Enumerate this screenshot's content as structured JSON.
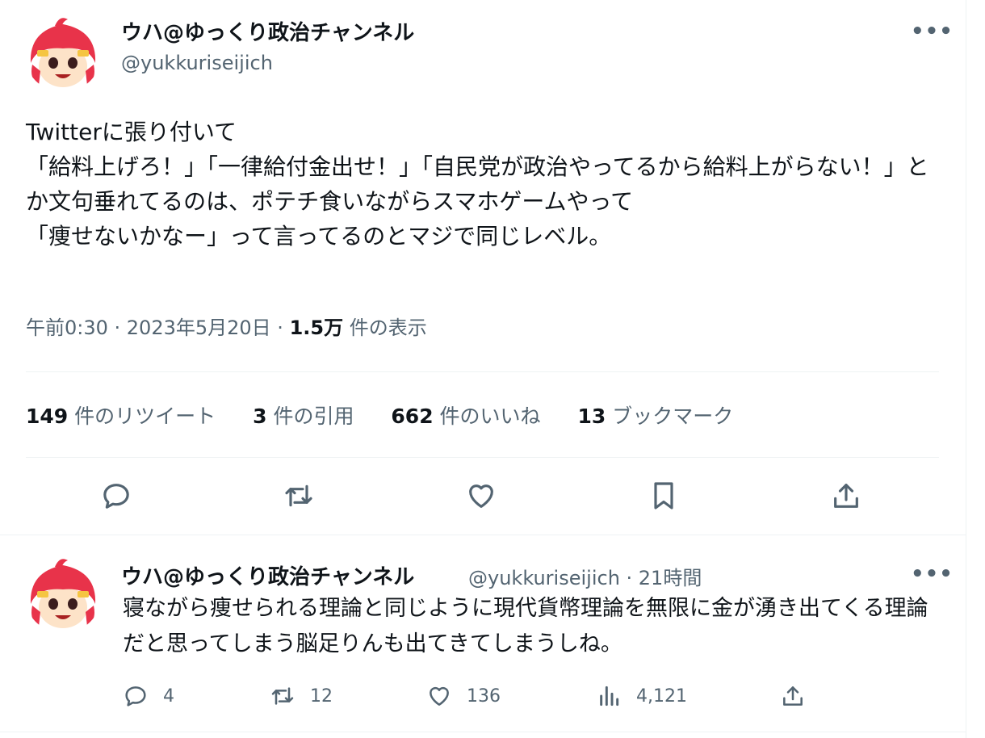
{
  "tweet": {
    "display_name": "ウハ@ゆっくり政治チャンネル",
    "handle": "@yukkuriseijich",
    "more": "•••",
    "text": "Twitterに張り付いて\n「給料上げろ！」「一律給付金出せ！」「自民党が政治やってるから給料上がらない！」とか文句垂れてるのは、ポテチ食いながらスマホゲームやって\n「痩せないかなー」って言ってるのとマジで同じレベル。",
    "time": "午前0:30 · 2023年5月20日 · ",
    "views_count": "1.5万",
    "views_label": " 件の表示",
    "stats": [
      {
        "count": "149",
        "label": " 件のリツイート"
      },
      {
        "count": "3",
        "label": " 件の引用"
      },
      {
        "count": "662",
        "label": " 件のいいね"
      },
      {
        "count": "13",
        "label": " ブックマーク"
      }
    ],
    "actions": [
      "reply-icon",
      "retweet-icon",
      "like-icon",
      "bookmark-icon",
      "share-icon"
    ]
  },
  "reply": {
    "display_name": "ウハ@ゆっくり政治チャンネル",
    "handle_time": "@yukkuriseijich · 21時間",
    "more": "•••",
    "text": "寝ながら痩せられる理論と同じように現代貨幣理論を無限に金が湧き出てくる理論だと思ってしまう脳足りんも出てきてしまうしね。",
    "reply_count": "4",
    "retweet_count": "12",
    "like_count": "136",
    "view_count": "4,121"
  },
  "colors": {
    "text": "#0f1419",
    "secondary": "#536471",
    "divider": "#eff3f4",
    "avatar_hair": "#e8334a"
  }
}
